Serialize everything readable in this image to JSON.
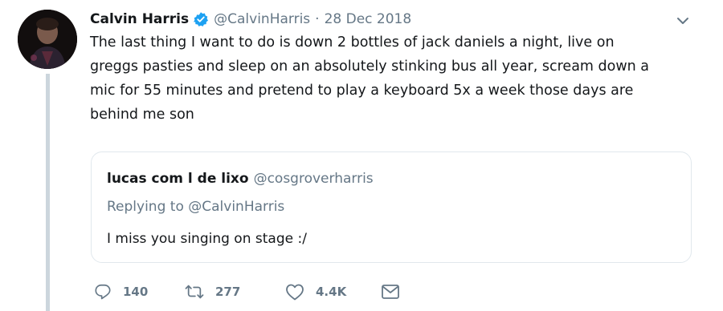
{
  "tweet": {
    "author": {
      "display_name": "Calvin Harris",
      "verified": true,
      "handle": "@CalvinHarris"
    },
    "separator": "·",
    "date": "28 Dec 2018",
    "text_lines": [
      "The last thing I want to do is down 2 bottles of jack daniels a night, live on",
      "greggs pasties and sleep on an absolutely stinking bus all year, scream down a",
      "mic for 55 minutes and pretend to play a keyboard 5x a week those days are",
      "behind me son"
    ],
    "quoted_tweet": {
      "display_name": "lucas com l de lixo",
      "handle": "@cosgroverharris",
      "replying_to": "Replying to @CalvinHarris",
      "text": "I miss you singing on stage :/"
    },
    "actions": {
      "reply_count": "140",
      "retweet_count": "277",
      "like_count": "4.4K"
    },
    "icons": {
      "verified": "verified-badge-icon",
      "caret": "chevron-down-icon",
      "reply": "reply-bubble-icon",
      "retweet": "retweet-arrows-icon",
      "like": "heart-icon",
      "dm": "envelope-icon"
    },
    "colors": {
      "verified_blue": "#1da1f2",
      "secondary_text": "#657786",
      "primary_text": "#14171a",
      "border": "#e1e8ed",
      "thread_line": "#ccd6dd"
    }
  }
}
